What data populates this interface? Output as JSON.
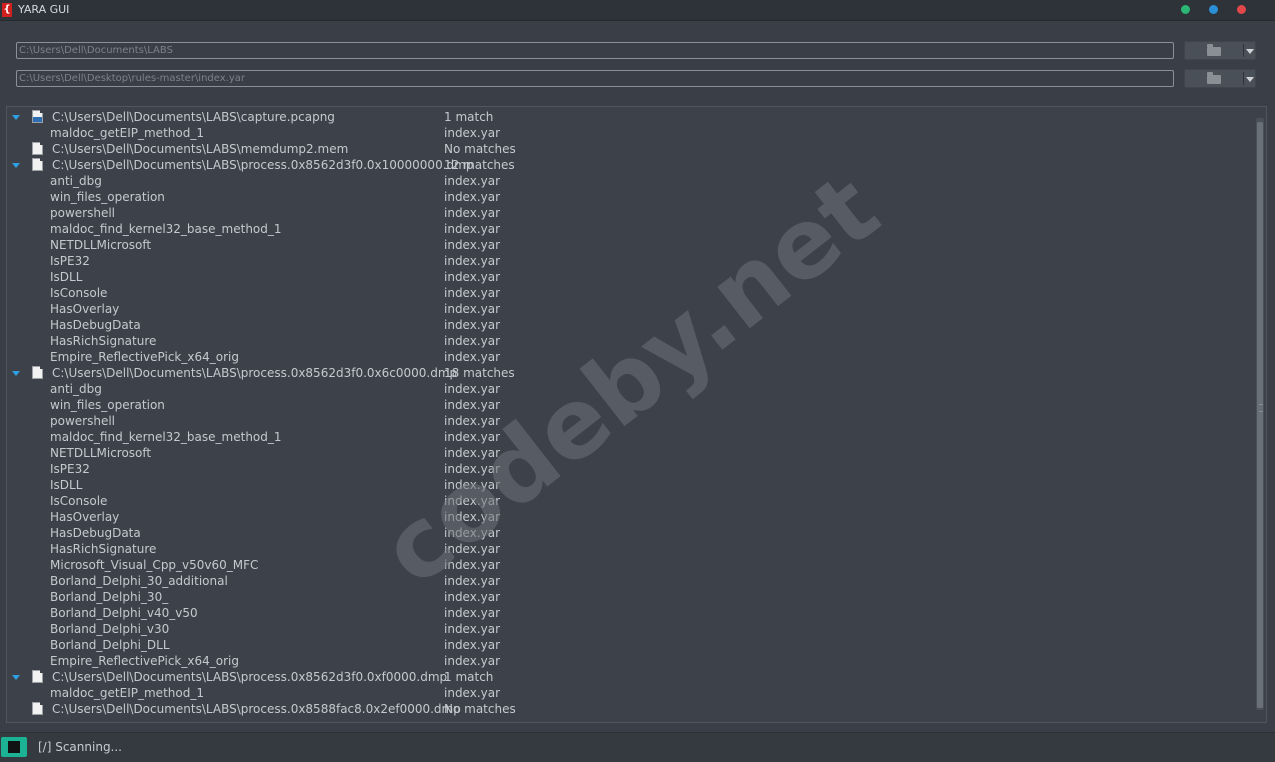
{
  "window": {
    "title": "YARA GUI"
  },
  "inputs": {
    "target_path": "C:\\Users\\Dell\\Documents\\LABS",
    "rules_path": "C:\\Users\\Dell\\Desktop\\rules-master\\index.yar"
  },
  "results": {
    "rows": [
      {
        "kind": "file",
        "icon": "binary-file-icon",
        "expanded": true,
        "name": "C:\\Users\\Dell\\Documents\\LABS\\capture.pcapng",
        "value": "1 match"
      },
      {
        "kind": "rule",
        "name": "maldoc_getEIP_method_1",
        "value": "index.yar"
      },
      {
        "kind": "file",
        "icon": "file-icon",
        "expanded": false,
        "name": "C:\\Users\\Dell\\Documents\\LABS\\memdump2.mem",
        "value": "No matches"
      },
      {
        "kind": "file",
        "icon": "file-icon",
        "expanded": true,
        "name": "C:\\Users\\Dell\\Documents\\LABS\\process.0x8562d3f0.0x10000000.dmp",
        "value": "12 matches"
      },
      {
        "kind": "rule",
        "name": "anti_dbg",
        "value": "index.yar"
      },
      {
        "kind": "rule",
        "name": "win_files_operation",
        "value": "index.yar"
      },
      {
        "kind": "rule",
        "name": "powershell",
        "value": "index.yar"
      },
      {
        "kind": "rule",
        "name": "maldoc_find_kernel32_base_method_1",
        "value": "index.yar"
      },
      {
        "kind": "rule",
        "name": "NETDLLMicrosoft",
        "value": "index.yar"
      },
      {
        "kind": "rule",
        "name": "IsPE32",
        "value": "index.yar"
      },
      {
        "kind": "rule",
        "name": "IsDLL",
        "value": "index.yar"
      },
      {
        "kind": "rule",
        "name": "IsConsole",
        "value": "index.yar"
      },
      {
        "kind": "rule",
        "name": "HasOverlay",
        "value": "index.yar"
      },
      {
        "kind": "rule",
        "name": "HasDebugData",
        "value": "index.yar"
      },
      {
        "kind": "rule",
        "name": "HasRichSignature",
        "value": "index.yar"
      },
      {
        "kind": "rule",
        "name": "Empire_ReflectivePick_x64_orig",
        "value": "index.yar"
      },
      {
        "kind": "file",
        "icon": "file-icon",
        "expanded": true,
        "name": "C:\\Users\\Dell\\Documents\\LABS\\process.0x8562d3f0.0x6c0000.dmp",
        "value": "18 matches"
      },
      {
        "kind": "rule",
        "name": "anti_dbg",
        "value": "index.yar"
      },
      {
        "kind": "rule",
        "name": "win_files_operation",
        "value": "index.yar"
      },
      {
        "kind": "rule",
        "name": "powershell",
        "value": "index.yar"
      },
      {
        "kind": "rule",
        "name": "maldoc_find_kernel32_base_method_1",
        "value": "index.yar"
      },
      {
        "kind": "rule",
        "name": "NETDLLMicrosoft",
        "value": "index.yar"
      },
      {
        "kind": "rule",
        "name": "IsPE32",
        "value": "index.yar"
      },
      {
        "kind": "rule",
        "name": "IsDLL",
        "value": "index.yar"
      },
      {
        "kind": "rule",
        "name": "IsConsole",
        "value": "index.yar"
      },
      {
        "kind": "rule",
        "name": "HasOverlay",
        "value": "index.yar"
      },
      {
        "kind": "rule",
        "name": "HasDebugData",
        "value": "index.yar"
      },
      {
        "kind": "rule",
        "name": "HasRichSignature",
        "value": "index.yar"
      },
      {
        "kind": "rule",
        "name": "Microsoft_Visual_Cpp_v50v60_MFC",
        "value": "index.yar"
      },
      {
        "kind": "rule",
        "name": "Borland_Delphi_30_additional",
        "value": "index.yar"
      },
      {
        "kind": "rule",
        "name": "Borland_Delphi_30_",
        "value": "index.yar"
      },
      {
        "kind": "rule",
        "name": "Borland_Delphi_v40_v50",
        "value": "index.yar"
      },
      {
        "kind": "rule",
        "name": "Borland_Delphi_v30",
        "value": "index.yar"
      },
      {
        "kind": "rule",
        "name": "Borland_Delphi_DLL",
        "value": "index.yar"
      },
      {
        "kind": "rule",
        "name": "Empire_ReflectivePick_x64_orig",
        "value": "index.yar"
      },
      {
        "kind": "file",
        "icon": "file-icon",
        "expanded": true,
        "name": "C:\\Users\\Dell\\Documents\\LABS\\process.0x8562d3f0.0xf0000.dmp",
        "value": "1 match"
      },
      {
        "kind": "rule",
        "name": "maldoc_getEIP_method_1",
        "value": "index.yar"
      },
      {
        "kind": "file",
        "icon": "file-icon",
        "expanded": false,
        "name": "C:\\Users\\Dell\\Documents\\LABS\\process.0x8588fac8.0x2ef0000.dmp",
        "value": "No matches"
      }
    ]
  },
  "status": {
    "text": "[/] Scanning..."
  },
  "watermark": {
    "text": "codeby.net"
  },
  "colors": {
    "accent": "#2e9fe0",
    "stop_button": "#1bb394",
    "background": "#3a3f47"
  }
}
